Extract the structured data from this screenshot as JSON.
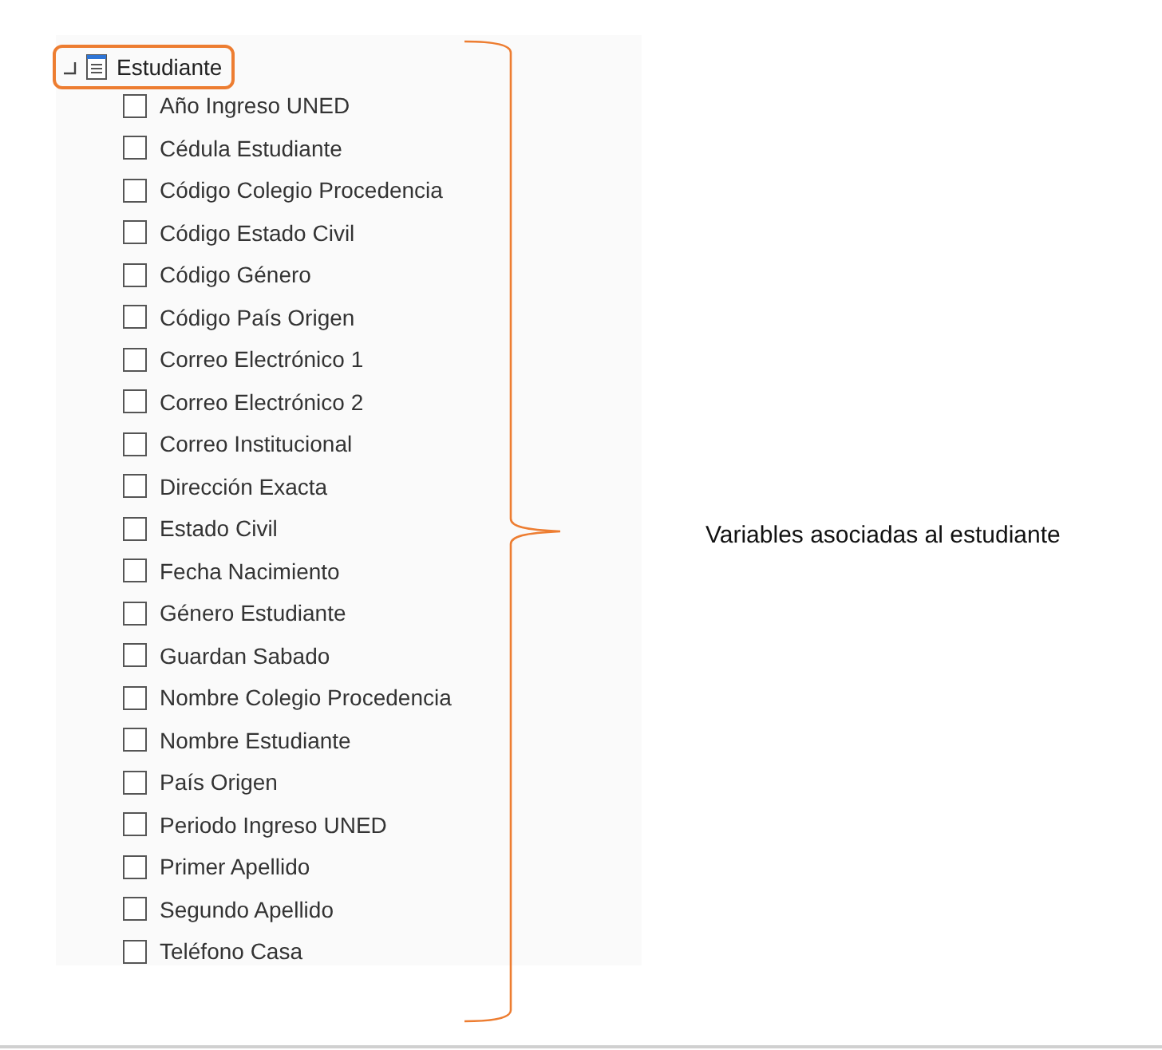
{
  "tree": {
    "label": "Estudiante",
    "expanded": true,
    "highlighted": true,
    "children": [
      {
        "label": "Año Ingreso UNED",
        "checked": false
      },
      {
        "label": "Cédula Estudiante",
        "checked": false
      },
      {
        "label": "Código Colegio Procedencia",
        "checked": false
      },
      {
        "label": "Código Estado Civil",
        "checked": false
      },
      {
        "label": "Código Género",
        "checked": false
      },
      {
        "label": "Código País Origen",
        "checked": false
      },
      {
        "label": "Correo Electrónico 1",
        "checked": false
      },
      {
        "label": "Correo Electrónico 2",
        "checked": false
      },
      {
        "label": "Correo Institucional",
        "checked": false
      },
      {
        "label": "Dirección Exacta",
        "checked": false
      },
      {
        "label": "Estado Civil",
        "checked": false
      },
      {
        "label": "Fecha Nacimiento",
        "checked": false
      },
      {
        "label": "Género Estudiante",
        "checked": false
      },
      {
        "label": "Guardan Sabado",
        "checked": false
      },
      {
        "label": "Nombre Colegio Procedencia",
        "checked": false
      },
      {
        "label": "Nombre Estudiante",
        "checked": false
      },
      {
        "label": "País Origen",
        "checked": false
      },
      {
        "label": "Periodo Ingreso UNED",
        "checked": false
      },
      {
        "label": "Primer Apellido",
        "checked": false
      },
      {
        "label": "Segundo Apellido",
        "checked": false
      },
      {
        "label": "Teléfono Casa",
        "checked": false
      }
    ]
  },
  "annotation": "Variables asociadas al estudiante"
}
